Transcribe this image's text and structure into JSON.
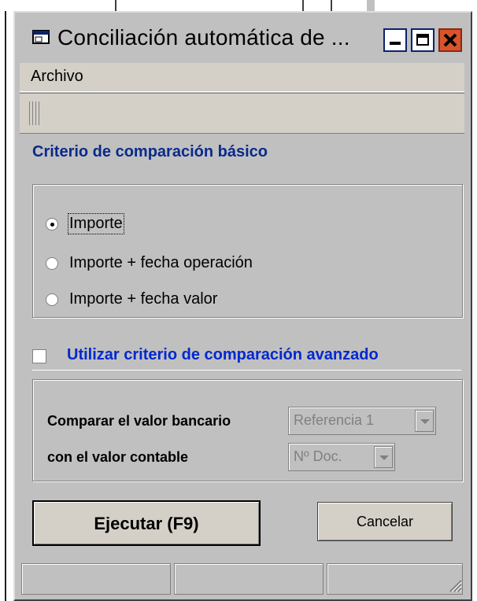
{
  "window": {
    "title": "Conciliación automática de ...",
    "controls": {
      "minimize": "minimize-icon",
      "maximize": "maximize-icon",
      "close": "close-icon"
    }
  },
  "menu": {
    "items": [
      "Archivo"
    ]
  },
  "basic": {
    "title": "Criterio de comparación básico",
    "options": [
      {
        "label": "Importe",
        "selected": true
      },
      {
        "label": "Importe + fecha operación",
        "selected": false
      },
      {
        "label": "Importe + fecha valor",
        "selected": false
      }
    ]
  },
  "advanced": {
    "label": "Utilizar criterio de comparación avanzado",
    "checked": false,
    "bank_label": "Comparar el valor bancario",
    "bank_value": "Referencia 1",
    "accounting_label": "con el valor contable",
    "accounting_value": "Nº Doc."
  },
  "buttons": {
    "execute": "Ejecutar (F9)",
    "cancel": "Cancelar"
  },
  "colors": {
    "face": "#c0c0c0",
    "accent_blue": "#0028d0",
    "close": "#d9542c"
  }
}
